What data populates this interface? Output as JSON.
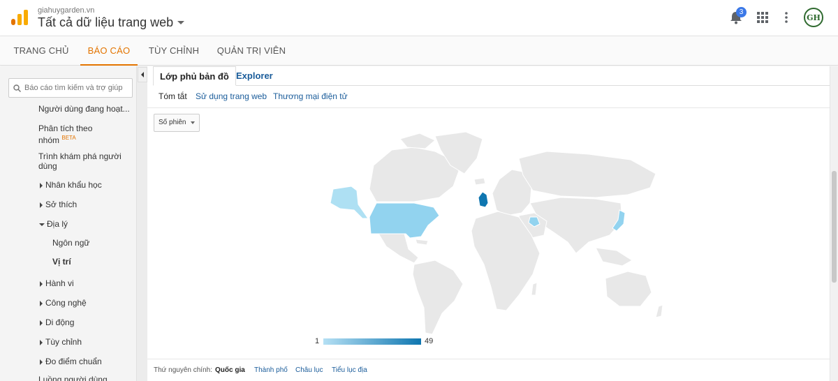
{
  "header": {
    "account_domain": "giahuygarden.vn",
    "property_view": "Tất cả dữ liệu trang web",
    "notification_count": "3",
    "avatar_initials": "GH"
  },
  "main_nav": {
    "tabs": [
      {
        "label": "TRANG CHỦ",
        "active": false
      },
      {
        "label": "BÁO CÁO",
        "active": true
      },
      {
        "label": "TÙY CHỈNH",
        "active": false
      },
      {
        "label": "QUẢN TRỊ VIÊN",
        "active": false
      }
    ],
    "accent_color": "#e37400"
  },
  "sidebar": {
    "search_placeholder": "Báo cáo tìm kiếm và trợ giúp",
    "items": [
      {
        "label": "Người dùng đang hoạt...",
        "expander": "none",
        "level": 1
      },
      {
        "label": "Phân tích theo nhóm",
        "badge": "BETA",
        "expander": "none",
        "level": 1
      },
      {
        "label": "Trình khám phá người dùng",
        "expander": "none",
        "level": 1
      },
      {
        "label": "Nhân khẩu học",
        "expander": "collapsed",
        "level": 1
      },
      {
        "label": "Sở thích",
        "expander": "collapsed",
        "level": 1
      },
      {
        "label": "Địa lý",
        "expander": "expanded",
        "level": 1
      },
      {
        "label": "Ngôn ngữ",
        "expander": "none",
        "level": 2
      },
      {
        "label": "Vị trí",
        "expander": "none",
        "level": 2,
        "selected": true
      },
      {
        "label": "Hành vi",
        "expander": "collapsed",
        "level": 1
      },
      {
        "label": "Công nghệ",
        "expander": "collapsed",
        "level": 1
      },
      {
        "label": "Di động",
        "expander": "collapsed",
        "level": 1
      },
      {
        "label": "Tùy chỉnh",
        "expander": "collapsed",
        "level": 1
      },
      {
        "label": "Đo điểm chuẩn",
        "expander": "collapsed",
        "level": 1
      },
      {
        "label": "Luồng người dùng",
        "expander": "none",
        "level": 1
      }
    ]
  },
  "content": {
    "view_tabs": [
      {
        "label": "Lớp phủ bản đồ",
        "active": true
      },
      {
        "label": "Explorer",
        "active": false
      }
    ],
    "sub_tabs": [
      {
        "label": "Tóm tắt",
        "active": true
      },
      {
        "label": "Sử dụng trang web",
        "active": false
      },
      {
        "label": "Thương mại điện tử",
        "active": false
      }
    ],
    "metric_selector": "Số phiên",
    "map": {
      "highlighted_regions": [
        "Alaska",
        "United States",
        "United Kingdom",
        "Iraq",
        "Japan"
      ],
      "color_scale": {
        "min": "1",
        "max": "49",
        "min_color": "#b5e0f4",
        "max_color": "#0f76b0"
      },
      "land_color": "#e8e8e8",
      "border_color": "#ffffff"
    },
    "primary_dimension": {
      "label": "Thứ nguyên chính:",
      "options": [
        {
          "label": "Quốc gia",
          "active": true
        },
        {
          "label": "Thành phố",
          "active": false
        },
        {
          "label": "Châu lục",
          "active": false
        },
        {
          "label": "Tiểu lục địa",
          "active": false
        }
      ]
    }
  }
}
